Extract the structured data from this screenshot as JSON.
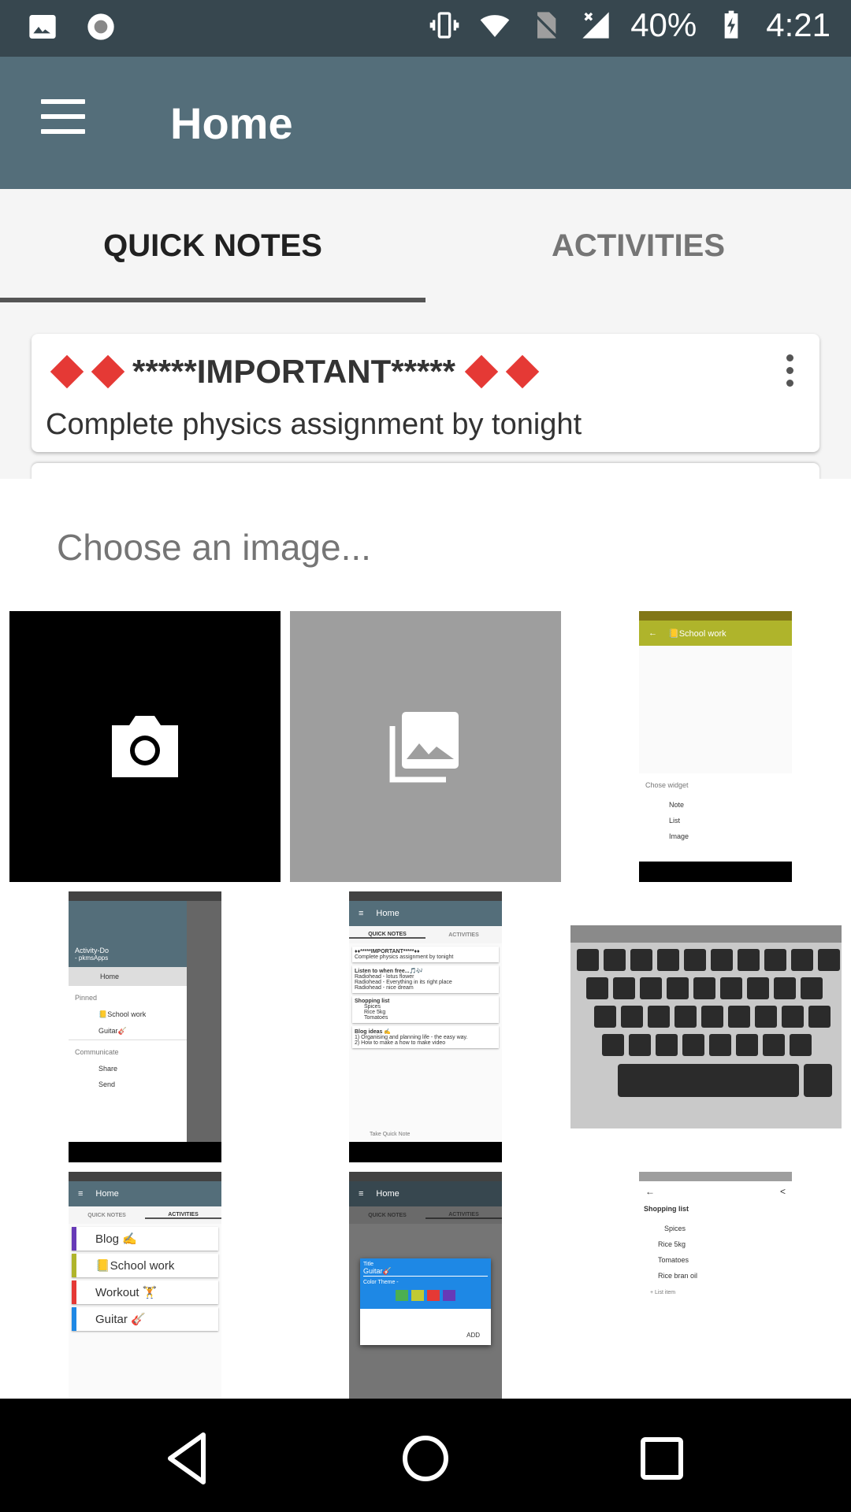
{
  "status_bar": {
    "battery": "40%",
    "time": "4:21",
    "icons": [
      "image-icon",
      "record-icon",
      "vibrate-icon",
      "wifi-icon",
      "no-sim-icon",
      "signal-icon",
      "battery-icon"
    ]
  },
  "app_bar": {
    "title": "Home",
    "menu_icon": "menu-icon"
  },
  "tabs": [
    {
      "label": "QUICK NOTES",
      "active": true
    },
    {
      "label": "ACTIVITIES",
      "active": false
    }
  ],
  "note": {
    "title": "*****IMPORTANT*****",
    "body": "Complete physics assignment by tonight"
  },
  "sheet": {
    "title": "Choose an image...",
    "thumbs": {
      "school": {
        "title": "📒School work",
        "chose_widget": "Chose widget",
        "items": [
          "Note",
          "List",
          "Image"
        ]
      },
      "drawer": {
        "app_name": "Activity-Do",
        "app_sub": "- pkmsApps",
        "home": "Home",
        "pinned": "Pinned",
        "pinned_items": [
          "📒School work",
          "Guitar🎸"
        ],
        "communicate": "Communicate",
        "comm_items": [
          "Share",
          "Send"
        ]
      },
      "home_notes": {
        "title": "Home",
        "tab1": "QUICK NOTES",
        "tab2": "ACTIVITIES",
        "n1_title": "♦♦*****IMPORTANT*****♦♦",
        "n1_body": "Complete physics assignment by tonight",
        "n2_title": "Listen to when free...🎵🎶",
        "n2_lines": [
          "Radiohead - lotus flower",
          "Radiohead - Everything in its right place",
          "Radiohead - nice dream"
        ],
        "n3_title": "Shopping list",
        "n3_items": [
          "Spices",
          "Rice 5kg",
          "Tomatoes"
        ],
        "n4_title": "Blog ideas ✍",
        "n4_lines": [
          "1) Organising and planning life - the easy way.",
          "2) How to make a how to make video"
        ],
        "quick_note": "Take Quick Note"
      },
      "activities": {
        "title": "Home",
        "tab1": "QUICK NOTES",
        "tab2": "ACTIVITIES",
        "items": [
          "Blog ✍",
          "📒School work",
          "Workout 🏋",
          "Guitar 🎸"
        ]
      },
      "dialog": {
        "title": "Home",
        "tab1": "QUICK NOTES",
        "tab2": "ACTIVITIES",
        "label_title": "Title",
        "value": "Guitar🎸",
        "color_theme": "Color Theme -",
        "add": "ADD",
        "swatches": [
          "#4caf50",
          "#c0ca33",
          "#e53935",
          "#673ab7"
        ]
      },
      "shopping": {
        "title": "Shopping list",
        "items": [
          "Spices",
          "Rice 5kg",
          "Tomatoes",
          "Rice bran oil"
        ],
        "add": "+ List item"
      }
    }
  },
  "colors": {
    "status_bar": "#37474f",
    "app_bar": "#546e7a",
    "school_bar": "#afb42b",
    "accent_red": "#e53935"
  }
}
